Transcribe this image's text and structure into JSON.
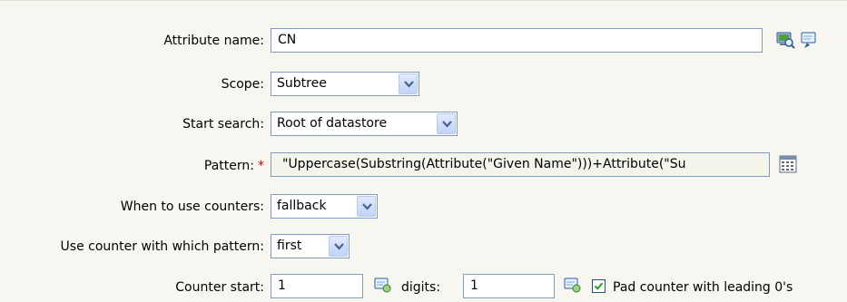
{
  "form": {
    "attribute_name": {
      "label": "Attribute name:",
      "value": "CN"
    },
    "scope": {
      "label": "Scope:",
      "value": "Subtree"
    },
    "start_search": {
      "label": "Start search:",
      "value": "Root of datastore"
    },
    "pattern": {
      "label": "Pattern:",
      "required_marker": "*",
      "value": "\"Uppercase(Substring(Attribute(\"Given Name\")))+Attribute(\"Su"
    },
    "when_counters": {
      "label": "When to use counters:",
      "value": "fallback"
    },
    "counter_pattern": {
      "label": "Use counter with which pattern:",
      "value": "first"
    },
    "counter_start": {
      "label": "Counter start:",
      "value": "1"
    },
    "digits": {
      "label": "digits:",
      "value": "1"
    },
    "pad_counter": {
      "label": "Pad counter with leading 0's",
      "checked": true
    }
  },
  "icons": {
    "attribute_browse": "browse-icon",
    "attribute_edit": "edit-icon",
    "pattern_builder": "pattern-builder-icon",
    "counter_start_edit": "edit-icon",
    "digits_edit": "edit-icon"
  },
  "colors": {
    "panel_background": "#f7f6f0",
    "field_border": "#7f9db9",
    "required_marker": "#d40000"
  }
}
